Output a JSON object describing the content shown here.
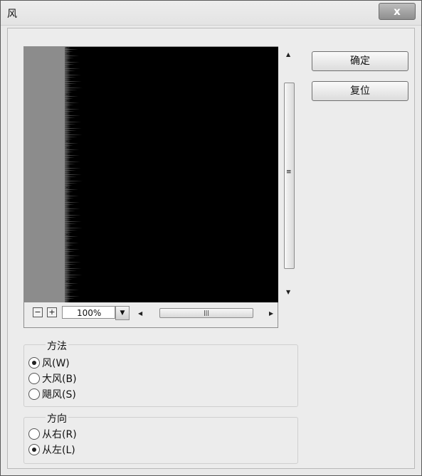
{
  "window": {
    "title": "风",
    "close_label": "x"
  },
  "preview": {
    "zoom_out_label": "−",
    "zoom_in_label": "+",
    "zoom_value": "100%",
    "scroll_thumb_grip": "|||",
    "vscroll_thumb_grip": "≡"
  },
  "buttons": {
    "ok_label": "确定",
    "reset_label": "复位"
  },
  "method": {
    "title": "方法",
    "options": [
      {
        "label": "风(W)",
        "checked": true
      },
      {
        "label": "大风(B)",
        "checked": false
      },
      {
        "label": "飓风(S)",
        "checked": false
      }
    ]
  },
  "direction": {
    "title": "方向",
    "options": [
      {
        "label": "从右(R)",
        "checked": false
      },
      {
        "label": "从左(L)",
        "checked": true
      }
    ]
  }
}
